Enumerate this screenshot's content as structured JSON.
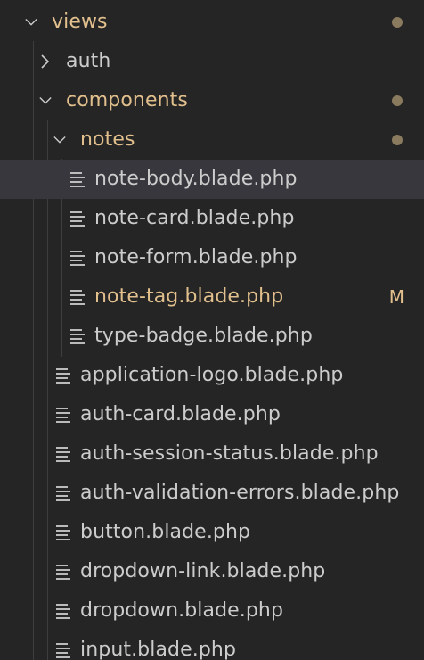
{
  "colors": {
    "background": "#252526",
    "selected_row": "#37373d",
    "modified_text": "#e2c08d",
    "default_text": "#cccccc",
    "dot": "#8a7a5e"
  },
  "tree": {
    "views": {
      "label": "views",
      "expanded": true,
      "has_changes_dot": true
    },
    "auth": {
      "label": "auth",
      "expanded": false
    },
    "components": {
      "label": "components",
      "expanded": true,
      "has_changes_dot": true
    },
    "notes": {
      "label": "notes",
      "expanded": true,
      "has_changes_dot": true
    },
    "files_in_notes": [
      {
        "label": "note-body.blade.php",
        "selected": true,
        "icon": "lines-file-icon"
      },
      {
        "label": "note-card.blade.php",
        "icon": "lines-file-icon"
      },
      {
        "label": "note-form.blade.php",
        "icon": "lines-file-icon"
      },
      {
        "label": "note-tag.blade.php",
        "modified": true,
        "badge": "M",
        "icon": "lines-file-icon"
      },
      {
        "label": "type-badge.blade.php",
        "icon": "lines-file-icon"
      }
    ],
    "files_in_components": [
      {
        "label": "application-logo.blade.php",
        "icon": "lines-file-icon"
      },
      {
        "label": "auth-card.blade.php",
        "icon": "lines-file-icon"
      },
      {
        "label": "auth-session-status.blade.php",
        "icon": "lines-file-icon"
      },
      {
        "label": "auth-validation-errors.blade.php",
        "icon": "lines-file-icon"
      },
      {
        "label": "button.blade.php",
        "icon": "lines-file-icon"
      },
      {
        "label": "dropdown-link.blade.php",
        "icon": "lines-file-icon"
      },
      {
        "label": "dropdown.blade.php",
        "icon": "lines-file-icon"
      },
      {
        "label": "input.blade.php",
        "icon": "lines-file-icon"
      }
    ]
  }
}
